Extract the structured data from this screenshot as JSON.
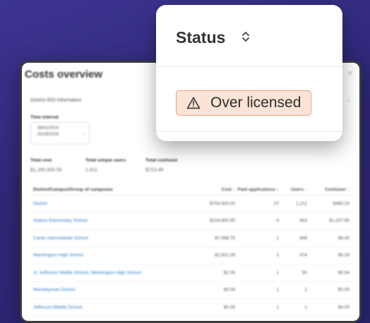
{
  "costs": {
    "title": "Costs overview",
    "close": "×",
    "subtitle": "District ROI information",
    "time_interval_label": "Time interval",
    "date_start": "08/01/2024",
    "date_end": "02/19/2025",
    "stats": [
      {
        "label": "Total cost",
        "value": "$1,165,500.50"
      },
      {
        "label": "Total unique users",
        "value": "1,611"
      },
      {
        "label": "Total cost/user",
        "value": "$723.46"
      }
    ],
    "columns": [
      "District/Campus/Group of campuses",
      "Cost ↑",
      "Paid applications ↑",
      "Users ↑",
      "Cost/user ↑"
    ],
    "rows": [
      {
        "name": "District",
        "cost": "$754,500.00",
        "paid": "27",
        "users": "1,211",
        "cpu": "$460.15"
      },
      {
        "name": "Adams Elementary School",
        "cost": "$104,900.95",
        "paid": "4",
        "users": "463",
        "cpu": "$1,207.95"
      },
      {
        "name": "Carter Intermediate School",
        "cost": "$7,998.75",
        "paid": "1",
        "users": "466",
        "cpu": "$9.40"
      },
      {
        "name": "Washington High School",
        "cost": "$2,501.09",
        "paid": "2",
        "users": "474",
        "cpu": "$5.28"
      },
      {
        "name": "Jr. Jefferson Middle School, Washington High School",
        "cost": "$2.09",
        "paid": "1",
        "users": "55",
        "cpu": "$0.04"
      },
      {
        "name": "Wendelyman District",
        "cost": "$0.09",
        "paid": "1",
        "users": "1",
        "cpu": "$0.00"
      },
      {
        "name": "Jefferson Middle School",
        "cost": "$0.09",
        "paid": "1",
        "users": "1",
        "cpu": "$0.00"
      }
    ]
  },
  "status": {
    "title": "Status",
    "sort_icon": "sort-updown-icon",
    "badge_label": "Over licensed",
    "badge_icon": "warning-triangle-icon",
    "badge_bg": "#fbe3d5",
    "badge_border": "#e8a47d"
  }
}
